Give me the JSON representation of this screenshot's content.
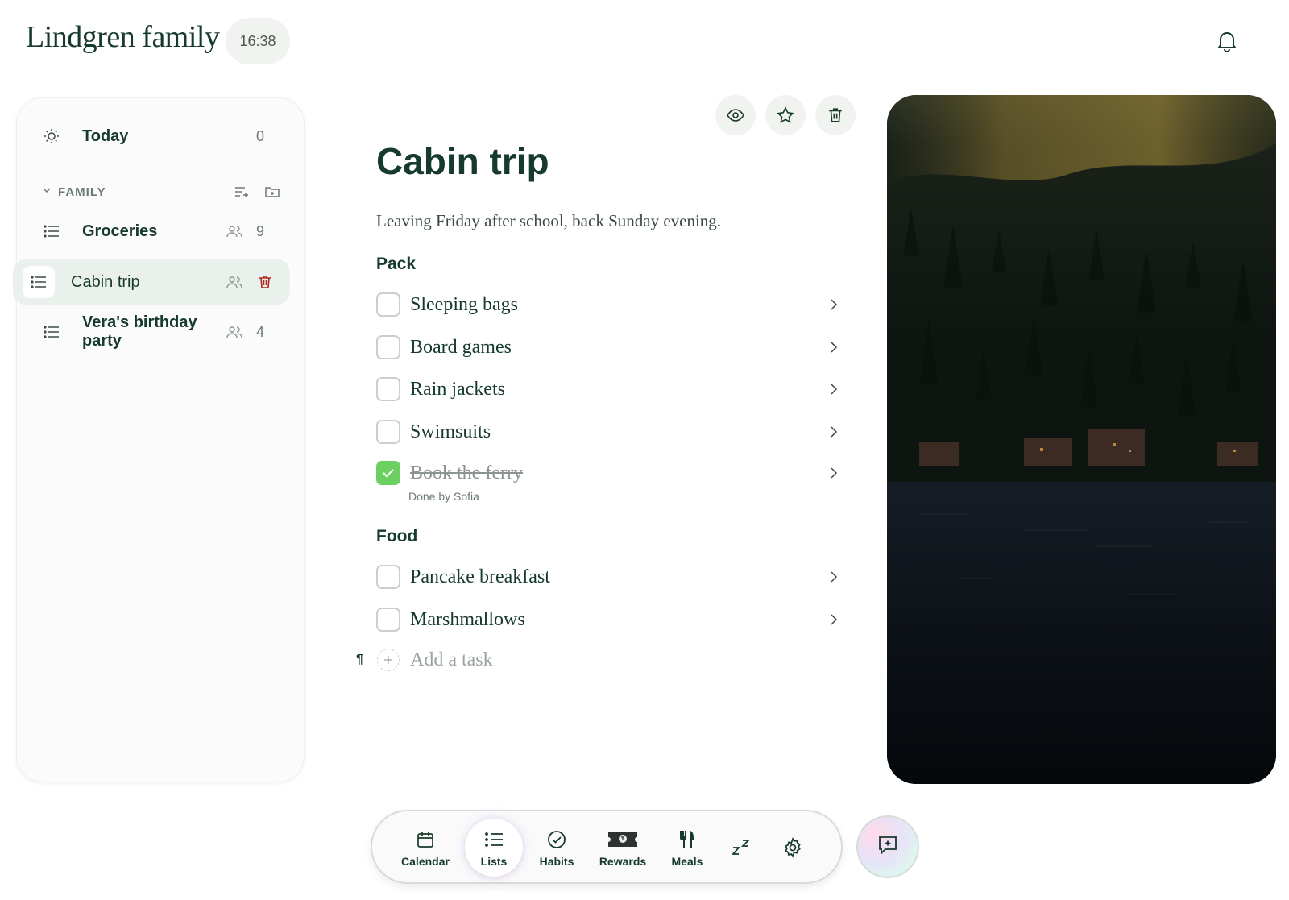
{
  "header": {
    "title": "Lindgren family",
    "time": "16:38"
  },
  "sidebar": {
    "today": {
      "label": "Today",
      "count": "0"
    },
    "section": {
      "label": "FAMILY"
    },
    "lists": [
      {
        "label": "Groceries",
        "count": "9",
        "shared": true
      },
      {
        "label": "Cabin trip",
        "count": "",
        "shared": true,
        "active": true
      },
      {
        "label": "Vera's birthday party",
        "count": "4",
        "shared": true
      }
    ]
  },
  "list": {
    "title": "Cabin trip",
    "description": "Leaving Friday after school, back Sunday evening.",
    "sections": [
      {
        "title": "Pack",
        "tasks": [
          {
            "text": "Sleeping bags",
            "done": false
          },
          {
            "text": "Board games",
            "done": false
          },
          {
            "text": "Rain jackets",
            "done": false
          },
          {
            "text": "Swimsuits",
            "done": false
          },
          {
            "text": "Book the ferry",
            "done": true,
            "sub": "Done by Sofia"
          }
        ]
      },
      {
        "title": "Food",
        "tasks": [
          {
            "text": "Pancake breakfast",
            "done": false
          },
          {
            "text": "Marshmallows",
            "done": false
          }
        ]
      }
    ],
    "add_task_placeholder": "Add a task",
    "pilcrow": "¶"
  },
  "nav": {
    "items": [
      {
        "label": "Calendar",
        "icon": "calendar-icon"
      },
      {
        "label": "Lists",
        "icon": "list-icon",
        "active": true
      },
      {
        "label": "Habits",
        "icon": "check-circle-icon"
      },
      {
        "label": "Rewards",
        "icon": "ticket-icon"
      },
      {
        "label": "Meals",
        "icon": "utensils-icon"
      },
      {
        "label": "",
        "icon": "sleep-icon"
      },
      {
        "label": "",
        "icon": "gear-icon"
      }
    ]
  },
  "colors": {
    "brand": "#163a2b",
    "checked": "#6bcf62",
    "delete": "#b3261e"
  }
}
